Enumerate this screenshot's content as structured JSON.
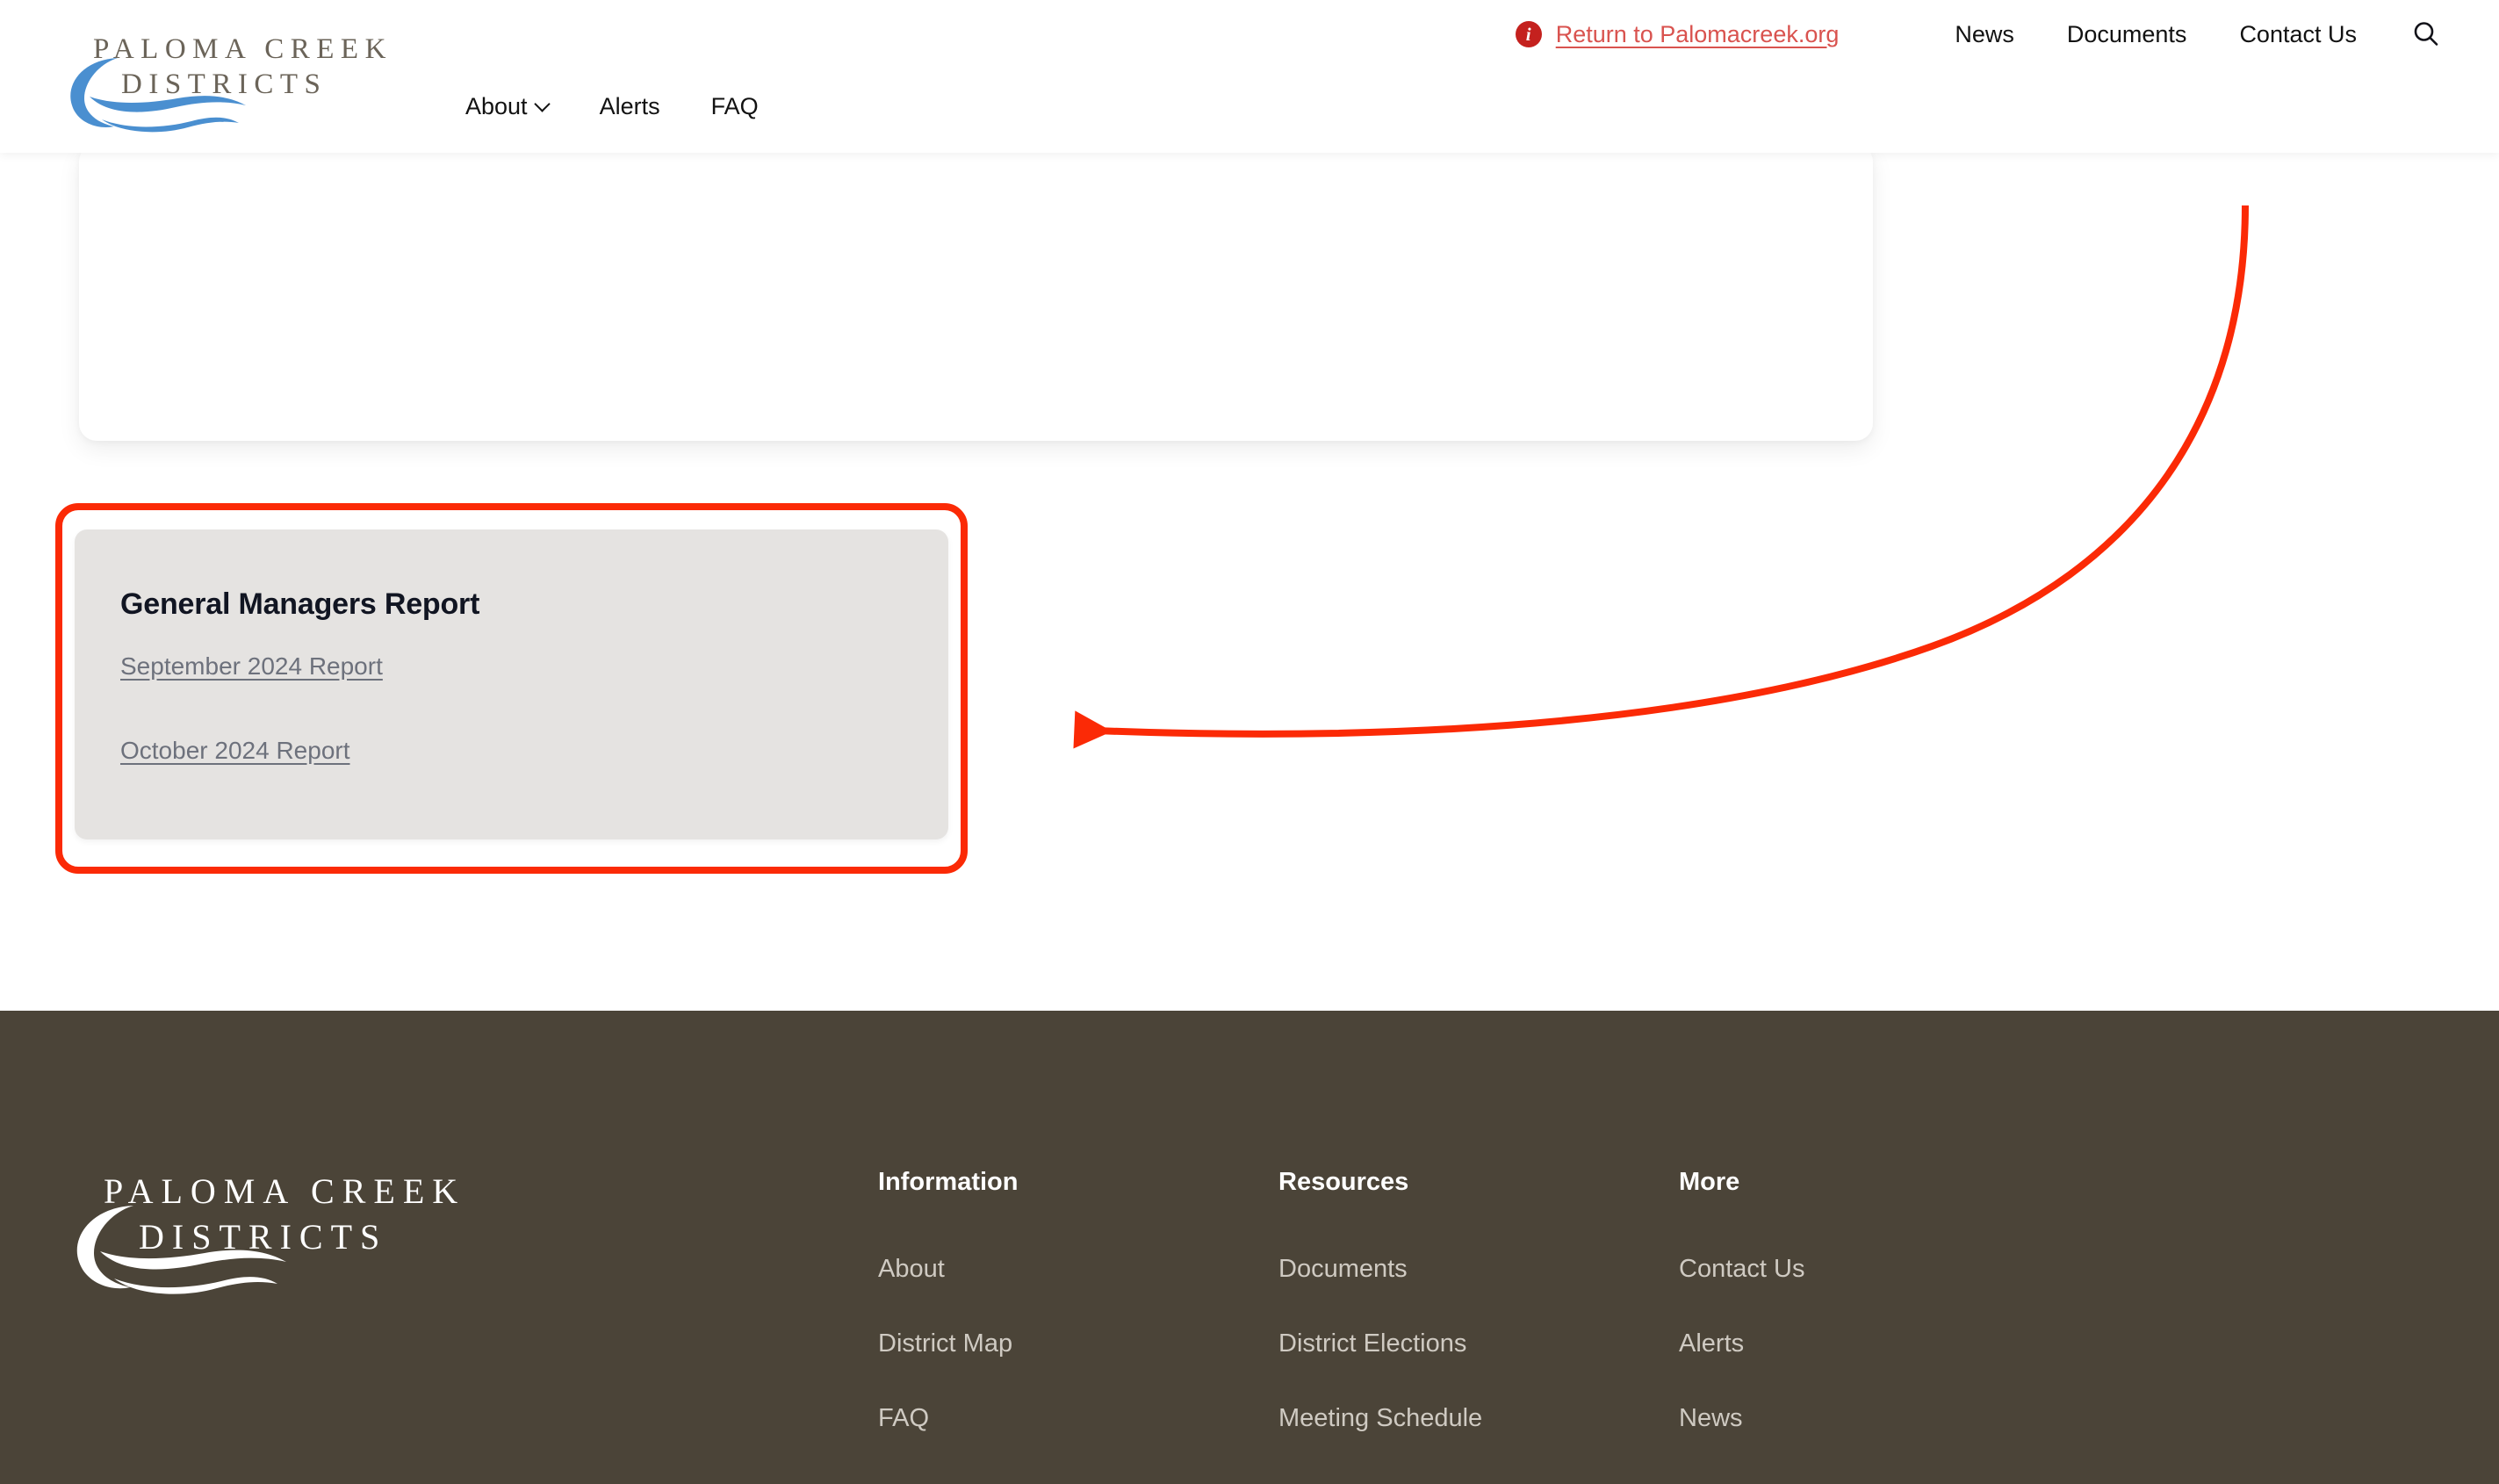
{
  "header": {
    "logo": {
      "line1": "PALOMA CREEK",
      "line2": "DISTRICTS",
      "swoosh_color": "#4a8fd0"
    },
    "main_nav": [
      {
        "label": "About",
        "has_dropdown": true
      },
      {
        "label": "Alerts",
        "has_dropdown": false
      },
      {
        "label": "FAQ",
        "has_dropdown": false
      }
    ],
    "notice": {
      "icon": "info-icon",
      "link_label": "Return to Palomacreek.org",
      "link_color": "#d9534f",
      "badge_color": "#c4211e"
    },
    "util_nav": [
      {
        "label": "News"
      },
      {
        "label": "Documents"
      },
      {
        "label": "Contact Us"
      }
    ],
    "search": {
      "icon": "search-icon"
    }
  },
  "main": {
    "top_card": {
      "content": ""
    },
    "report_card": {
      "title": "General Managers Report",
      "background": "#e5e3e1",
      "links": [
        {
          "label": "September 2024 Report"
        },
        {
          "label": "October 2024 Report"
        }
      ]
    },
    "annotations": {
      "highlight_box": {
        "color": "#fb2a06",
        "target": "general-managers-report-card"
      },
      "arrow": {
        "color": "#fb2a06",
        "direction": "points-left-to-report-card"
      }
    }
  },
  "footer": {
    "background": "#4b4438",
    "logo": {
      "line1": "PALOMA CREEK",
      "line2": "DISTRICTS"
    },
    "columns": [
      {
        "title": "Information",
        "links": [
          {
            "label": "About"
          },
          {
            "label": "District Map"
          },
          {
            "label": "FAQ"
          }
        ]
      },
      {
        "title": "Resources",
        "links": [
          {
            "label": "Documents"
          },
          {
            "label": "District Elections"
          },
          {
            "label": "Meeting Schedule"
          }
        ]
      },
      {
        "title": "More",
        "links": [
          {
            "label": "Contact Us"
          },
          {
            "label": "Alerts"
          },
          {
            "label": "News"
          }
        ]
      }
    ]
  }
}
